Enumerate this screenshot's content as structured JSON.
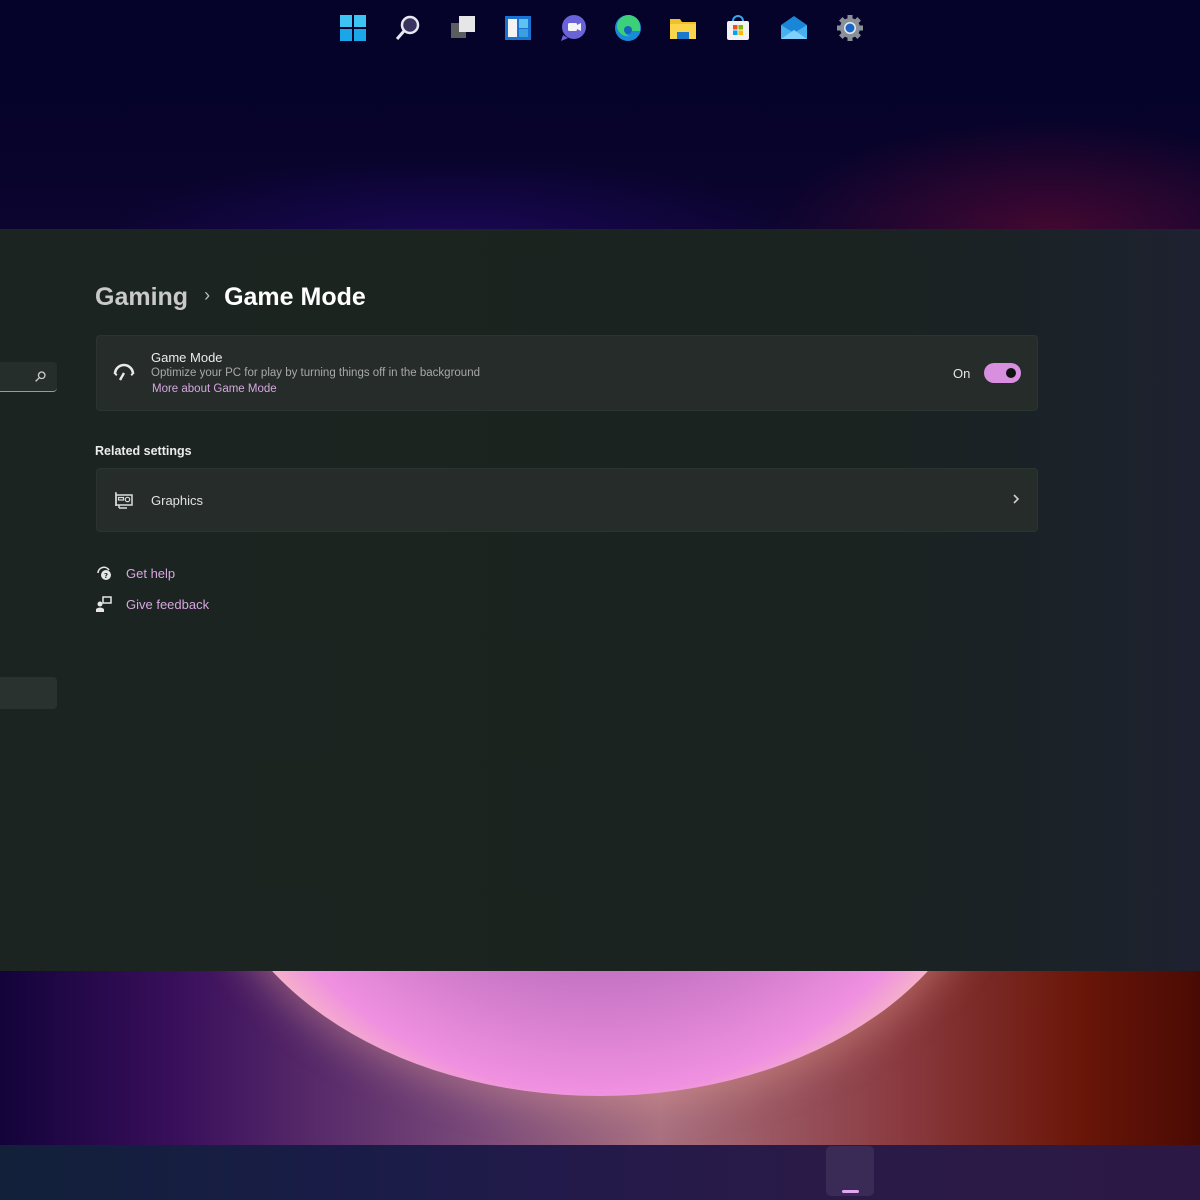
{
  "breadcrumb": {
    "parent": "Gaming",
    "separator": "›",
    "current": "Game Mode"
  },
  "game_mode_card": {
    "title": "Game Mode",
    "description": "Optimize your PC for play by turning things off in the background",
    "link": "More about Game Mode",
    "toggle_state_label": "On",
    "toggle_on": true,
    "icon": "speedometer-icon"
  },
  "related_settings": {
    "title": "Related settings",
    "items": [
      {
        "label": "Graphics",
        "icon": "graphics-card-icon"
      }
    ]
  },
  "help_links": {
    "get_help": "Get help",
    "give_feedback": "Give feedback"
  },
  "colors": {
    "accent": "#d88fe0",
    "link": "#d7a6e0",
    "window_bg": "#1c2421",
    "card_bg": "#252c2a"
  },
  "taskbar": {
    "items": [
      {
        "name": "start",
        "icon": "windows-start-icon"
      },
      {
        "name": "search",
        "icon": "search-icon"
      },
      {
        "name": "task-view",
        "icon": "task-view-icon"
      },
      {
        "name": "widgets",
        "icon": "widgets-icon"
      },
      {
        "name": "chat",
        "icon": "teams-chat-icon"
      },
      {
        "name": "edge",
        "icon": "edge-browser-icon"
      },
      {
        "name": "file-explorer",
        "icon": "folder-icon"
      },
      {
        "name": "store",
        "icon": "store-icon"
      },
      {
        "name": "mail",
        "icon": "mail-icon"
      },
      {
        "name": "settings",
        "icon": "settings-gear-icon",
        "active": true
      }
    ]
  }
}
